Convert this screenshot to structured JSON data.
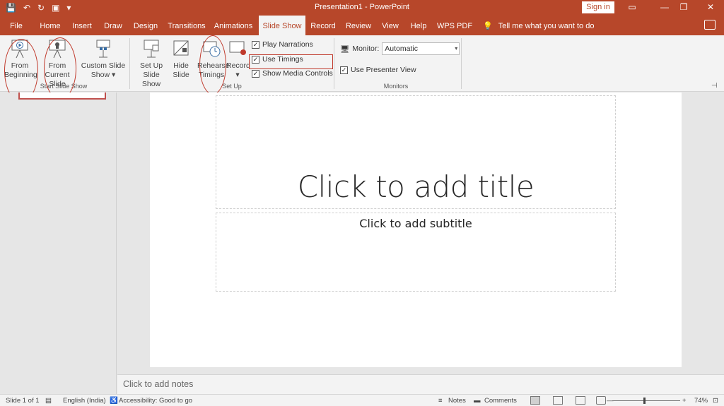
{
  "window": {
    "title": "Presentation1 - PowerPoint",
    "signin": "Sign in",
    "controls": [
      "▭",
      "—",
      "❐",
      "✕"
    ],
    "qat_icons": [
      "save-icon",
      "undo-icon",
      "redo-icon",
      "present-icon",
      "customize-icon"
    ]
  },
  "tabs": [
    {
      "label": "File"
    },
    {
      "label": "Home"
    },
    {
      "label": "Insert"
    },
    {
      "label": "Draw"
    },
    {
      "label": "Design"
    },
    {
      "label": "Transitions"
    },
    {
      "label": "Animations"
    },
    {
      "label": "Slide Show",
      "active": true
    },
    {
      "label": "Record"
    },
    {
      "label": "Review"
    },
    {
      "label": "View"
    },
    {
      "label": "Help"
    },
    {
      "label": "WPS PDF"
    }
  ],
  "tell_me": "Tell me what you want to do",
  "ribbon": {
    "start_group": {
      "label": "Start Slide Show",
      "from_beginning": [
        "From",
        "Beginning"
      ],
      "from_current": [
        "From",
        "Current Slide"
      ],
      "custom": [
        "Custom Slide",
        "Show ▾"
      ]
    },
    "setup_group": {
      "label": "Set Up",
      "setup_show": [
        "Set Up",
        "Slide Show"
      ],
      "hide_slide": [
        "Hide",
        "Slide"
      ],
      "rehearse": [
        "Rehearse",
        "Timings"
      ],
      "record": [
        "Record",
        "▾"
      ],
      "checks": [
        {
          "label": "Play Narrations",
          "checked": true
        },
        {
          "label": "Use Timings",
          "checked": true
        },
        {
          "label": "Show Media Controls",
          "checked": true
        }
      ]
    },
    "monitors_group": {
      "label": "Monitors",
      "monitor_label": "Monitor:",
      "monitor_value": "Automatic",
      "presenter_label": "Use Presenter View",
      "presenter_checked": true
    }
  },
  "slide": {
    "title_placeholder": "Click to add title",
    "subtitle_placeholder": "Click to add subtitle"
  },
  "notes_placeholder": "Click to add notes",
  "status": {
    "slide": "Slide 1 of 1",
    "language": "English (India)",
    "accessibility": "Accessibility: Good to go",
    "notes": "Notes",
    "comments": "Comments",
    "zoom": "74%",
    "minus": "—",
    "plus": "+"
  },
  "colors": {
    "accent": "#b7472a",
    "annotation": "#c0392b"
  }
}
